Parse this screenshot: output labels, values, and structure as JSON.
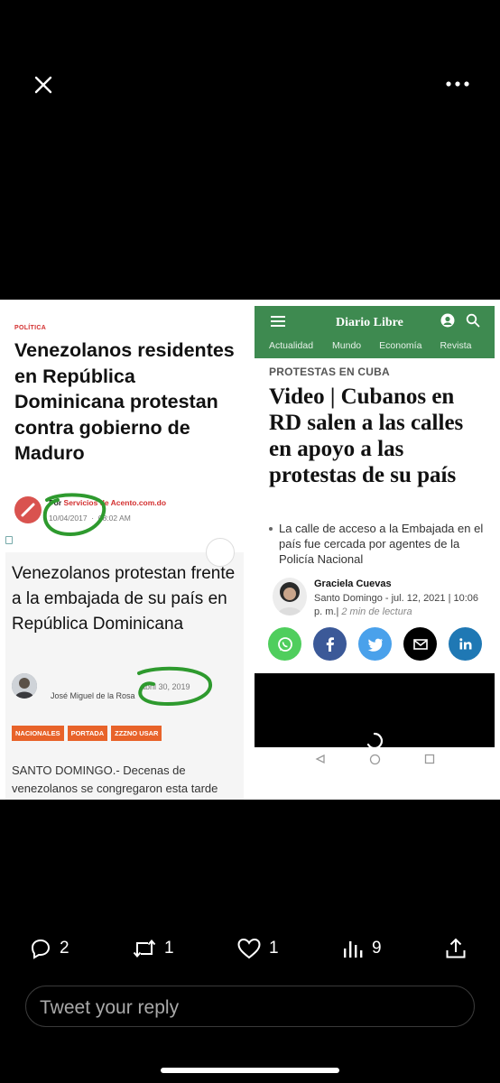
{
  "topbar": {
    "close_icon": "close-icon",
    "more_icon": "more-icon"
  },
  "acento": {
    "section": "POLÍTICA",
    "headline": "Venezolanos residentes en República Dominicana protestan contra gobierno de Maduro",
    "byline_prefix": "Por ",
    "byline_source": "Servicios de Acento.com.do",
    "date": "10/04/2017",
    "time": "08:02 AM"
  },
  "venez": {
    "headline": "Venezolanos protestan frente a la embajada de su país en República Dominicana",
    "date": "abril 30, 2019",
    "author": "José Miguel de la Rosa",
    "tags": [
      "NACIONALES",
      "PORTADA",
      "ZZZNO USAR"
    ],
    "body": "SANTO DOMINGO.- Decenas de venezolanos se congregaron esta tarde"
  },
  "diario": {
    "logo": "Diario Libre",
    "nav": [
      "Actualidad",
      "Mundo",
      "Economía",
      "Revista"
    ],
    "kicker": "PROTESTAS EN CUBA",
    "headline": "Video | Cubanos en RD salen a las calles en apoyo a las protestas de su país",
    "summary": "La calle de acceso a la Embajada en el país fue cercada por agentes de la Policía Nacional",
    "reporter": "Graciela Cuevas",
    "place_date": "Santo Domingo - jul. 12, 2021 | 10:06 p. m.|",
    "read_time": "2 min de lectura",
    "share_colors": {
      "whatsapp": "#4fce5d",
      "facebook": "#3b5998",
      "twitter": "#4aa1eb",
      "email": "#000000",
      "linkedin": "#1f78b4"
    }
  },
  "tweet": {
    "replies": "2",
    "retweets": "1",
    "likes": "1",
    "views": "9",
    "reply_placeholder": "Tweet your reply"
  }
}
